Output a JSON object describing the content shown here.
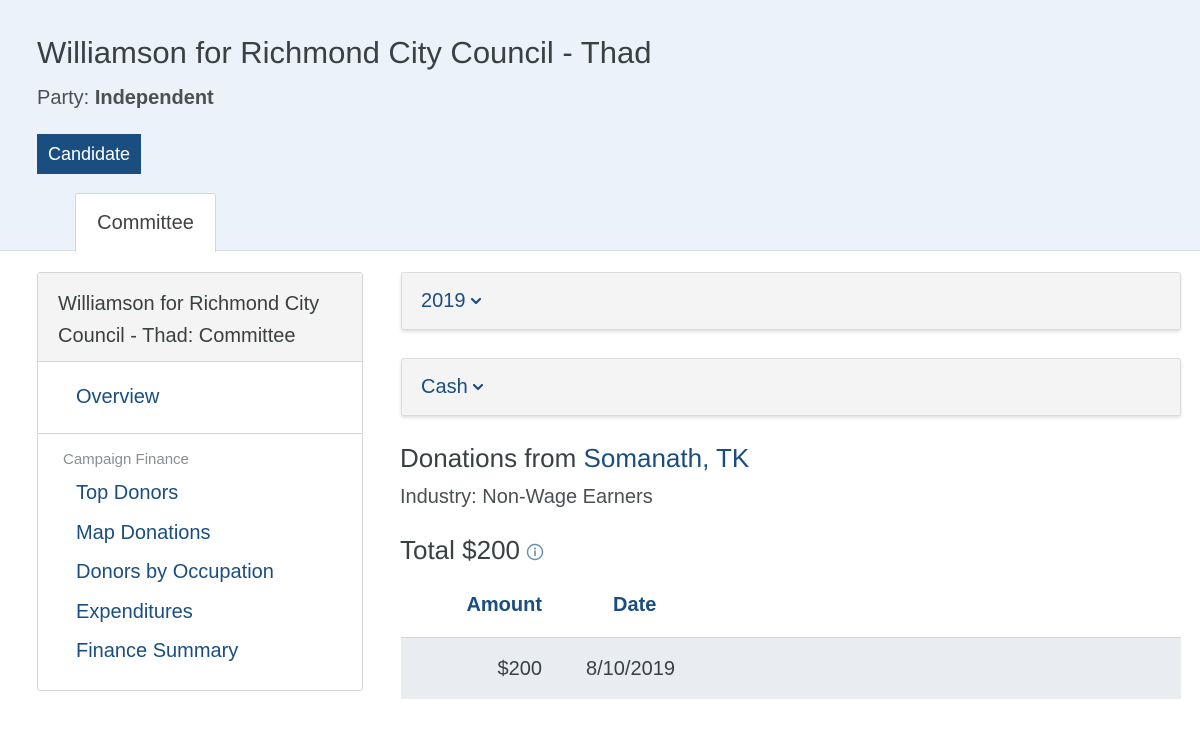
{
  "header": {
    "title": "Williamson for Richmond City Council - Thad",
    "party_label": "Party:",
    "party_value": "Independent",
    "candidate_button": "Candidate",
    "tab_label": "Committee"
  },
  "sidebar": {
    "heading": "Williamson for Richmond City Council - Thad: Committee",
    "overview": "Overview",
    "category": "Campaign Finance",
    "items": [
      "Top Donors",
      "Map Donations",
      "Donors by Occupation",
      "Expenditures",
      "Finance Summary"
    ]
  },
  "filters": {
    "year": "2019",
    "type": "Cash"
  },
  "donation": {
    "title_prefix": "Donations from",
    "donor_name": "Somanath, TK",
    "industry": "Industry: Non-Wage Earners",
    "total": "Total $200",
    "columns": [
      "Amount",
      "Date"
    ],
    "rows": [
      {
        "amount": "$200",
        "date": "8/10/2019"
      }
    ]
  },
  "icons": {
    "chevron": "chevron-down-icon",
    "info": "info-icon"
  },
  "colors": {
    "link": "#1a4e80",
    "header_bg": "#ebf2fa",
    "button_bg": "#1a4e80",
    "row_bg": "#e9edf1"
  }
}
